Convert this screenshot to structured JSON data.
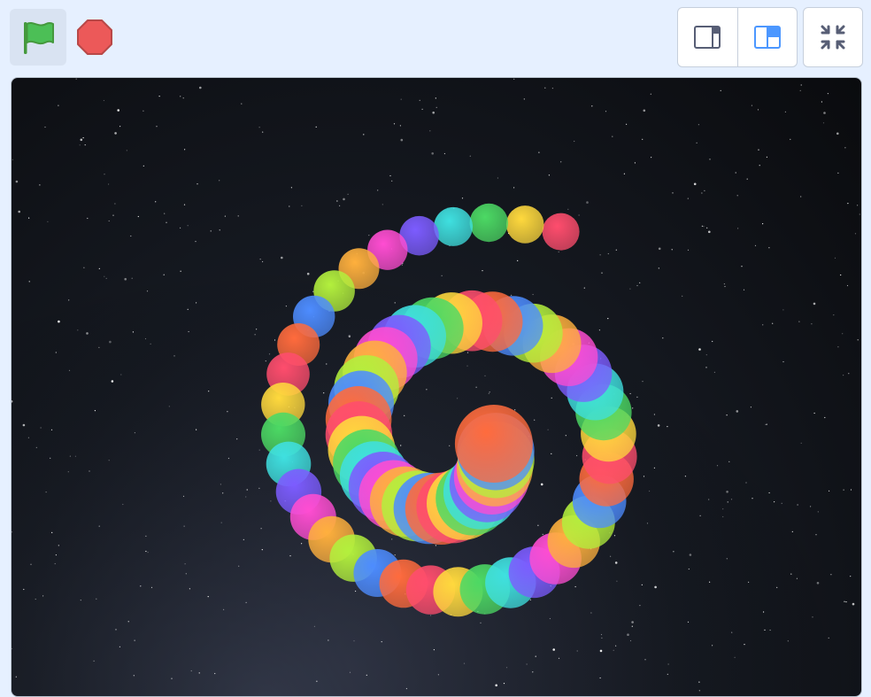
{
  "toolbar": {
    "green_flag": {
      "icon": "green-flag-icon",
      "color": "#4cbf56"
    },
    "stop": {
      "icon": "stop-sign-icon",
      "color": "#ec5959"
    },
    "small_stage": {
      "icon": "small-stage-layout-icon",
      "selected": false
    },
    "normal_stage": {
      "icon": "normal-stage-layout-icon",
      "selected": true
    },
    "fullscreen": {
      "icon": "fullscreen-icon"
    }
  },
  "stage": {
    "backdrop": "starry-night-sky",
    "accent": "#4c97ff",
    "ball_colors": [
      "#ff4d6d",
      "#ffd93d",
      "#4cd964",
      "#3fe0e0",
      "#7c5cff",
      "#ff4dd2",
      "#ffb03d",
      "#b3f03d",
      "#4d8cff",
      "#ff6b3d"
    ]
  }
}
